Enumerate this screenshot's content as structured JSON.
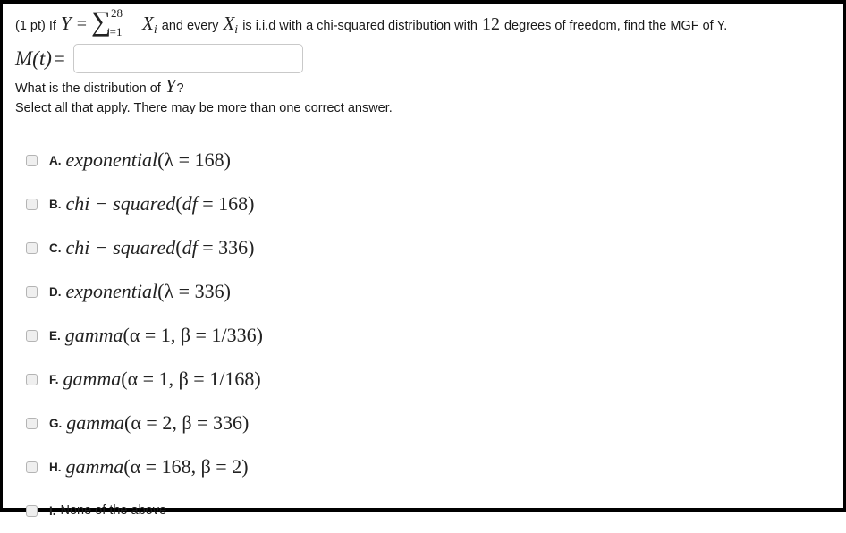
{
  "problem": {
    "points_label": "(1 pt)",
    "stem_if": "If",
    "sum_var": "Y",
    "equals": "=",
    "sum_upper": "28",
    "sum_lower_index": "i",
    "sum_lower_eq": "=",
    "sum_lower_start": "1",
    "sum_term_base": "X",
    "sum_term_sub": "i",
    "stem_mid": "and every",
    "term_base_2": "X",
    "term_sub_2": "i",
    "stem_tail_1": "is i.i.d with a chi-squared distribution with",
    "degrees": "12",
    "stem_tail_2": "degrees of freedom, find the MGF of Y."
  },
  "mgf": {
    "label_m": "M",
    "label_paren_open": "(",
    "label_t": "t",
    "label_paren_close": ")",
    "label_equals": "=",
    "input_value": "",
    "input_placeholder": ""
  },
  "question": {
    "line1_prefix": "What is the distribution of",
    "line1_var": "Y",
    "line1_suffix": "?",
    "line2": "Select all that apply. There may be more than one correct answer."
  },
  "options": [
    {
      "letter": "A.",
      "checked": false,
      "style": "math",
      "name": "exponential",
      "open": "(",
      "params": [
        {
          "symbol": "λ",
          "eq": "=",
          "value": "168"
        }
      ],
      "close": ")"
    },
    {
      "letter": "B.",
      "checked": false,
      "style": "math",
      "name": "chi − squared",
      "open": "(",
      "params": [
        {
          "symbol": "df",
          "eq": "=",
          "value": "168",
          "italic": true
        }
      ],
      "close": ")"
    },
    {
      "letter": "C.",
      "checked": false,
      "style": "math",
      "name": "chi − squared",
      "open": "(",
      "params": [
        {
          "symbol": "df",
          "eq": "=",
          "value": "336",
          "italic": true
        }
      ],
      "close": ")"
    },
    {
      "letter": "D.",
      "checked": false,
      "style": "math",
      "name": "exponential",
      "open": "(",
      "params": [
        {
          "symbol": "λ",
          "eq": "=",
          "value": "336"
        }
      ],
      "close": ")"
    },
    {
      "letter": "E.",
      "checked": false,
      "style": "math",
      "name": "gamma",
      "open": "(",
      "params": [
        {
          "symbol": "α",
          "eq": "=",
          "value": "1"
        },
        {
          "symbol": "β",
          "eq": "=",
          "value": "1/336"
        }
      ],
      "close": ")"
    },
    {
      "letter": "F.",
      "checked": false,
      "style": "math",
      "name": "gamma",
      "open": "(",
      "params": [
        {
          "symbol": "α",
          "eq": "=",
          "value": "1"
        },
        {
          "symbol": "β",
          "eq": "=",
          "value": "1/168"
        }
      ],
      "close": ")"
    },
    {
      "letter": "G.",
      "checked": false,
      "style": "math",
      "name": "gamma",
      "open": "(",
      "params": [
        {
          "symbol": "α",
          "eq": "=",
          "value": "2"
        },
        {
          "symbol": "β",
          "eq": "=",
          "value": "336"
        }
      ],
      "close": ")"
    },
    {
      "letter": "H.",
      "checked": false,
      "style": "math",
      "name": "gamma",
      "open": "(",
      "params": [
        {
          "symbol": "α",
          "eq": "=",
          "value": "168"
        },
        {
          "symbol": "β",
          "eq": "=",
          "value": "2"
        }
      ],
      "close": ")"
    },
    {
      "letter": "I.",
      "checked": false,
      "style": "plain",
      "text": "None of the above"
    }
  ],
  "colors": {
    "frame_border": "#000000",
    "text": "#1a1a1a",
    "math_text": "#222222",
    "input_border": "#c9c9c9",
    "checkbox_fill": "#efefef",
    "checkbox_border": "#b4b4b4"
  }
}
